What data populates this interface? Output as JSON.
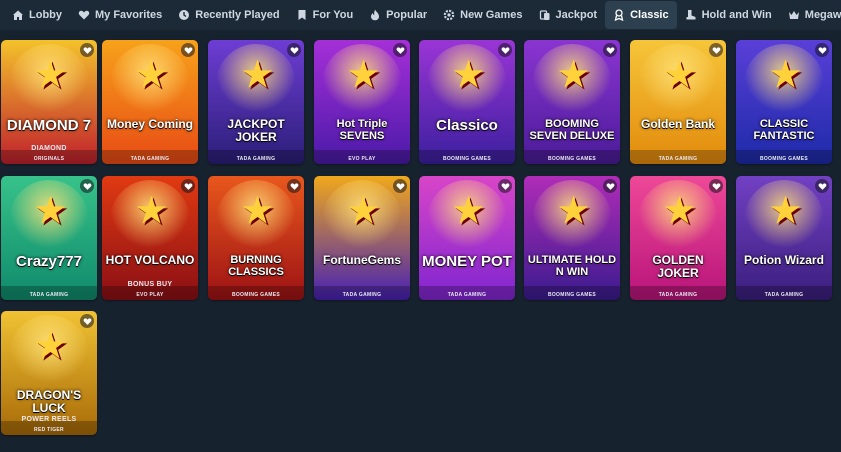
{
  "nav": {
    "tabs": [
      {
        "label": "Lobby",
        "icon": "home-icon",
        "active": false
      },
      {
        "label": "My Favorites",
        "icon": "heart-icon",
        "active": false
      },
      {
        "label": "Recently Played",
        "icon": "clock-icon",
        "active": false
      },
      {
        "label": "For You",
        "icon": "bookmark-icon",
        "active": false
      },
      {
        "label": "Popular",
        "icon": "flame-icon",
        "active": false
      },
      {
        "label": "New Games",
        "icon": "gear-icon",
        "active": false
      },
      {
        "label": "Jackpot",
        "icon": "coins-icon",
        "active": false
      },
      {
        "label": "Classic",
        "icon": "classic-icon",
        "active": true
      },
      {
        "label": "Hold and Win",
        "icon": "boot-icon",
        "active": false
      },
      {
        "label": "Megaways",
        "icon": "crown-icon",
        "active": false
      }
    ]
  },
  "games": [
    {
      "title": "DIAMOND 7",
      "subtitle": "DIAMOND",
      "provider": "ORIGINALS",
      "colors": [
        "#c0202c",
        "#f4c22b"
      ]
    },
    {
      "title": "Money Coming",
      "provider": "TADA GAMING",
      "colors": [
        "#e84a14",
        "#f7a21b"
      ]
    },
    {
      "title": "JACKPOT JOKER",
      "provider": "TADA GAMING",
      "colors": [
        "#2b1e78",
        "#6e3dd4"
      ]
    },
    {
      "title": "Hot Triple SEVENS",
      "provider": "EVO PLAY",
      "colors": [
        "#4a1aa8",
        "#a62fd8"
      ]
    },
    {
      "title": "Classico",
      "provider": "BOOMING GAMES",
      "colors": [
        "#3b1f9e",
        "#9a35d6"
      ]
    },
    {
      "title": "BOOMING SEVEN DELUXE",
      "provider": "BOOMING GAMES",
      "colors": [
        "#4a1b98",
        "#8b35d2"
      ]
    },
    {
      "title": "Golden Bank",
      "provider": "TADA GAMING",
      "colors": [
        "#e28a0c",
        "#f6c53a"
      ]
    },
    {
      "title": "CLASSIC FANTASTIC",
      "provider": "BOOMING GAMES",
      "colors": [
        "#1d2aa8",
        "#5a3fd8"
      ]
    },
    {
      "title": "Crazy777",
      "provider": "TADA GAMING",
      "colors": [
        "#0f8a6b",
        "#37c28a"
      ]
    },
    {
      "title": "HOT VOLCANO",
      "subtitle": "BONUS BUY",
      "provider": "EVO PLAY",
      "colors": [
        "#8a0f14",
        "#e03a12"
      ]
    },
    {
      "title": "BURNING CLASSICS",
      "provider": "BOOMING GAMES",
      "colors": [
        "#9d1215",
        "#e8571c"
      ]
    },
    {
      "title": "FortuneGems",
      "provider": "TADA GAMING",
      "colors": [
        "#4620b4",
        "#f0a81c"
      ]
    },
    {
      "title": "MONEY POT",
      "provider": "TADA GAMING",
      "colors": [
        "#7f25d0",
        "#d845c8"
      ]
    },
    {
      "title": "ULTIMATE HOLD N WIN",
      "provider": "BOOMING GAMES",
      "colors": [
        "#3a1b8e",
        "#b02cb8"
      ]
    },
    {
      "title": "GOLDEN JOKER",
      "provider": "TADA GAMING",
      "colors": [
        "#b8147a",
        "#ee4898"
      ]
    },
    {
      "title": "Potion Wizard",
      "provider": "TADA GAMING",
      "colors": [
        "#3a1e7c",
        "#7240c4"
      ]
    },
    {
      "title": "DRAGON'S LUCK",
      "subtitle": "POWER REELS",
      "provider": "RED TIGER",
      "colors": [
        "#a86a08",
        "#f0c233"
      ]
    }
  ]
}
